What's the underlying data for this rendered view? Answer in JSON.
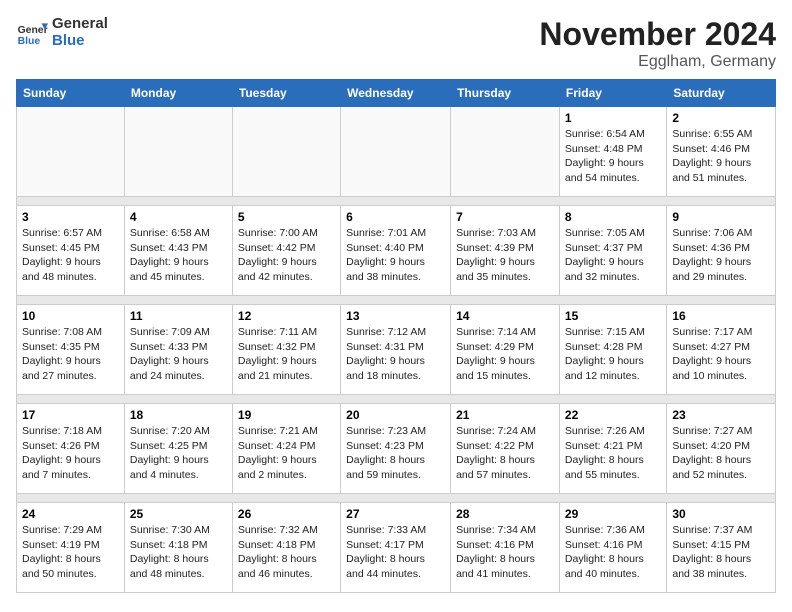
{
  "header": {
    "logo_line1": "General",
    "logo_line2": "Blue",
    "month": "November 2024",
    "location": "Egglham, Germany"
  },
  "weekdays": [
    "Sunday",
    "Monday",
    "Tuesday",
    "Wednesday",
    "Thursday",
    "Friday",
    "Saturday"
  ],
  "weeks": [
    [
      {
        "day": "",
        "info": ""
      },
      {
        "day": "",
        "info": ""
      },
      {
        "day": "",
        "info": ""
      },
      {
        "day": "",
        "info": ""
      },
      {
        "day": "",
        "info": ""
      },
      {
        "day": "1",
        "info": "Sunrise: 6:54 AM\nSunset: 4:48 PM\nDaylight: 9 hours\nand 54 minutes."
      },
      {
        "day": "2",
        "info": "Sunrise: 6:55 AM\nSunset: 4:46 PM\nDaylight: 9 hours\nand 51 minutes."
      }
    ],
    [
      {
        "day": "3",
        "info": "Sunrise: 6:57 AM\nSunset: 4:45 PM\nDaylight: 9 hours\nand 48 minutes."
      },
      {
        "day": "4",
        "info": "Sunrise: 6:58 AM\nSunset: 4:43 PM\nDaylight: 9 hours\nand 45 minutes."
      },
      {
        "day": "5",
        "info": "Sunrise: 7:00 AM\nSunset: 4:42 PM\nDaylight: 9 hours\nand 42 minutes."
      },
      {
        "day": "6",
        "info": "Sunrise: 7:01 AM\nSunset: 4:40 PM\nDaylight: 9 hours\nand 38 minutes."
      },
      {
        "day": "7",
        "info": "Sunrise: 7:03 AM\nSunset: 4:39 PM\nDaylight: 9 hours\nand 35 minutes."
      },
      {
        "day": "8",
        "info": "Sunrise: 7:05 AM\nSunset: 4:37 PM\nDaylight: 9 hours\nand 32 minutes."
      },
      {
        "day": "9",
        "info": "Sunrise: 7:06 AM\nSunset: 4:36 PM\nDaylight: 9 hours\nand 29 minutes."
      }
    ],
    [
      {
        "day": "10",
        "info": "Sunrise: 7:08 AM\nSunset: 4:35 PM\nDaylight: 9 hours\nand 27 minutes."
      },
      {
        "day": "11",
        "info": "Sunrise: 7:09 AM\nSunset: 4:33 PM\nDaylight: 9 hours\nand 24 minutes."
      },
      {
        "day": "12",
        "info": "Sunrise: 7:11 AM\nSunset: 4:32 PM\nDaylight: 9 hours\nand 21 minutes."
      },
      {
        "day": "13",
        "info": "Sunrise: 7:12 AM\nSunset: 4:31 PM\nDaylight: 9 hours\nand 18 minutes."
      },
      {
        "day": "14",
        "info": "Sunrise: 7:14 AM\nSunset: 4:29 PM\nDaylight: 9 hours\nand 15 minutes."
      },
      {
        "day": "15",
        "info": "Sunrise: 7:15 AM\nSunset: 4:28 PM\nDaylight: 9 hours\nand 12 minutes."
      },
      {
        "day": "16",
        "info": "Sunrise: 7:17 AM\nSunset: 4:27 PM\nDaylight: 9 hours\nand 10 minutes."
      }
    ],
    [
      {
        "day": "17",
        "info": "Sunrise: 7:18 AM\nSunset: 4:26 PM\nDaylight: 9 hours\nand 7 minutes."
      },
      {
        "day": "18",
        "info": "Sunrise: 7:20 AM\nSunset: 4:25 PM\nDaylight: 9 hours\nand 4 minutes."
      },
      {
        "day": "19",
        "info": "Sunrise: 7:21 AM\nSunset: 4:24 PM\nDaylight: 9 hours\nand 2 minutes."
      },
      {
        "day": "20",
        "info": "Sunrise: 7:23 AM\nSunset: 4:23 PM\nDaylight: 8 hours\nand 59 minutes."
      },
      {
        "day": "21",
        "info": "Sunrise: 7:24 AM\nSunset: 4:22 PM\nDaylight: 8 hours\nand 57 minutes."
      },
      {
        "day": "22",
        "info": "Sunrise: 7:26 AM\nSunset: 4:21 PM\nDaylight: 8 hours\nand 55 minutes."
      },
      {
        "day": "23",
        "info": "Sunrise: 7:27 AM\nSunset: 4:20 PM\nDaylight: 8 hours\nand 52 minutes."
      }
    ],
    [
      {
        "day": "24",
        "info": "Sunrise: 7:29 AM\nSunset: 4:19 PM\nDaylight: 8 hours\nand 50 minutes."
      },
      {
        "day": "25",
        "info": "Sunrise: 7:30 AM\nSunset: 4:18 PM\nDaylight: 8 hours\nand 48 minutes."
      },
      {
        "day": "26",
        "info": "Sunrise: 7:32 AM\nSunset: 4:18 PM\nDaylight: 8 hours\nand 46 minutes."
      },
      {
        "day": "27",
        "info": "Sunrise: 7:33 AM\nSunset: 4:17 PM\nDaylight: 8 hours\nand 44 minutes."
      },
      {
        "day": "28",
        "info": "Sunrise: 7:34 AM\nSunset: 4:16 PM\nDaylight: 8 hours\nand 41 minutes."
      },
      {
        "day": "29",
        "info": "Sunrise: 7:36 AM\nSunset: 4:16 PM\nDaylight: 8 hours\nand 40 minutes."
      },
      {
        "day": "30",
        "info": "Sunrise: 7:37 AM\nSunset: 4:15 PM\nDaylight: 8 hours\nand 38 minutes."
      }
    ]
  ]
}
